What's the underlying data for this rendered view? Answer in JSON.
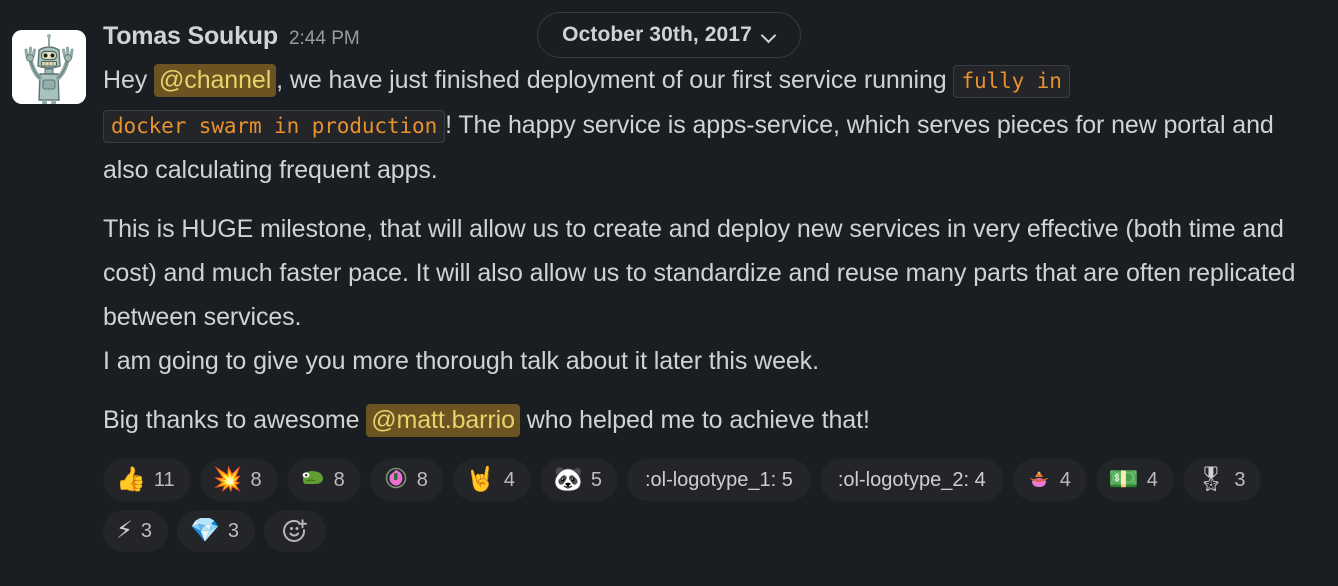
{
  "date_divider": {
    "label": "October 30th, 2017",
    "chevron_icon": "chevron-down-icon"
  },
  "message": {
    "avatar_alt": "bender-avatar",
    "sender": "Tomas Soukup",
    "timestamp": "2:44 PM",
    "paragraph1": {
      "before_mention": "Hey ",
      "mention": "@channel",
      "after_mention": ", we have just finished deployment of our first service running ",
      "code1": "fully in",
      "mid": " ",
      "code2": "docker swarm in production",
      "tail": "! The happy service is apps-service, which serves pieces for new portal and also calculating frequent apps."
    },
    "paragraph2": "This is HUGE milestone, that will allow us to create and deploy new services in very effective (both time and cost) and much faster pace. It will also allow us to standardize and reuse many parts that are often replicated between services.",
    "paragraph2b": "I am going to give you more thorough talk about it later this week.",
    "paragraph3": {
      "before_mention": "Big thanks to awesome ",
      "mention": "@matt.barrio",
      "after_mention": " who helped me to achieve that!"
    }
  },
  "reactions": [
    {
      "name": "thumbsup",
      "emoji": "👍",
      "count": "11",
      "kind": "emoji"
    },
    {
      "name": "boom",
      "emoji": "💥",
      "count": "8",
      "kind": "emoji"
    },
    {
      "name": "green-creature",
      "emoji": "",
      "count": "8",
      "kind": "custom-green"
    },
    {
      "name": "pink-creature",
      "emoji": "",
      "count": "8",
      "kind": "custom-pink"
    },
    {
      "name": "sign-of-horns",
      "emoji": "🤘",
      "count": "4",
      "kind": "emoji"
    },
    {
      "name": "panda-face",
      "emoji": "🐼",
      "count": "5",
      "kind": "emoji"
    },
    {
      "name": "ol-logotype-1",
      "label": ":ol-logotype_1: 5",
      "kind": "shortcode"
    },
    {
      "name": "ol-logotype-2",
      "label": ":ol-logotype_2: 4",
      "kind": "shortcode"
    },
    {
      "name": "sombrero-emoji",
      "emoji": "",
      "count": "4",
      "kind": "custom-sombrero"
    },
    {
      "name": "money-banknotes",
      "emoji": "💵",
      "count": "4",
      "kind": "emoji"
    },
    {
      "name": "medal",
      "emoji": "🎖",
      "count": "3",
      "kind": "emoji"
    },
    {
      "name": "zap",
      "emoji": "⚡",
      "count": "3",
      "kind": "emoji"
    },
    {
      "name": "gem",
      "emoji": "💎",
      "count": "3",
      "kind": "emoji"
    }
  ],
  "add_reaction": {
    "icon": "add-reaction-icon"
  },
  "colors": {
    "background": "#1a1d21",
    "text": "#d1d2d3",
    "muted_text": "#9a9b9e",
    "mention_bg": "#6b5322",
    "mention_text": "#e8d26a",
    "code_text": "#e8912d",
    "code_bg": "#232529",
    "pill_bg": "#232529",
    "divider_border": "#35383d"
  }
}
